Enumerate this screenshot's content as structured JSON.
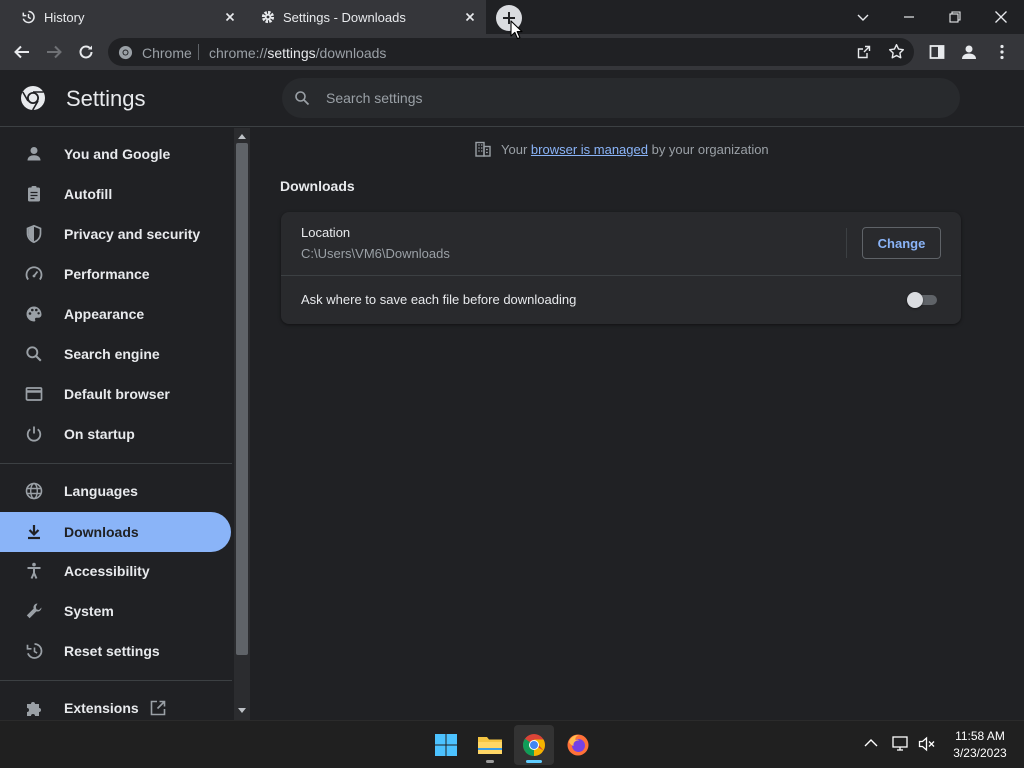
{
  "tabs": [
    {
      "title": "History",
      "icon": "history-icon"
    },
    {
      "title": "Settings - Downloads",
      "icon": "gear-icon"
    }
  ],
  "toolbar": {
    "site_chip": "Chrome",
    "url_prefix": "chrome://",
    "url_highlight": "settings",
    "url_suffix": "/downloads"
  },
  "settings": {
    "title": "Settings",
    "search_placeholder": "Search settings"
  },
  "sidebar": {
    "items": [
      {
        "label": "You and Google",
        "icon": "person-icon"
      },
      {
        "label": "Autofill",
        "icon": "clipboard-icon"
      },
      {
        "label": "Privacy and security",
        "icon": "shield-icon"
      },
      {
        "label": "Performance",
        "icon": "gauge-icon"
      },
      {
        "label": "Appearance",
        "icon": "palette-icon"
      },
      {
        "label": "Search engine",
        "icon": "search-icon"
      },
      {
        "label": "Default browser",
        "icon": "browser-icon"
      },
      {
        "label": "On startup",
        "icon": "power-icon"
      },
      {
        "label": "Languages",
        "icon": "globe-icon"
      },
      {
        "label": "Downloads",
        "icon": "download-icon",
        "active": true
      },
      {
        "label": "Accessibility",
        "icon": "accessibility-icon"
      },
      {
        "label": "System",
        "icon": "wrench-icon"
      },
      {
        "label": "Reset settings",
        "icon": "reset-icon"
      },
      {
        "label": "Extensions",
        "icon": "puzzle-icon"
      }
    ]
  },
  "main": {
    "managed_prefix": "Your",
    "managed_link": "browser is managed",
    "managed_suffix": "by your organization",
    "section_title": "Downloads",
    "location_label": "Location",
    "location_path": "C:\\Users\\VM6\\Downloads",
    "change_label": "Change",
    "ask_label": "Ask where to save each file before downloading",
    "ask_enabled": false
  },
  "taskbar": {
    "time": "11:58 AM",
    "date": "3/23/2023"
  },
  "colors": {
    "accent": "#8ab4f8",
    "background": "#202124",
    "surface": "#292a2d"
  }
}
